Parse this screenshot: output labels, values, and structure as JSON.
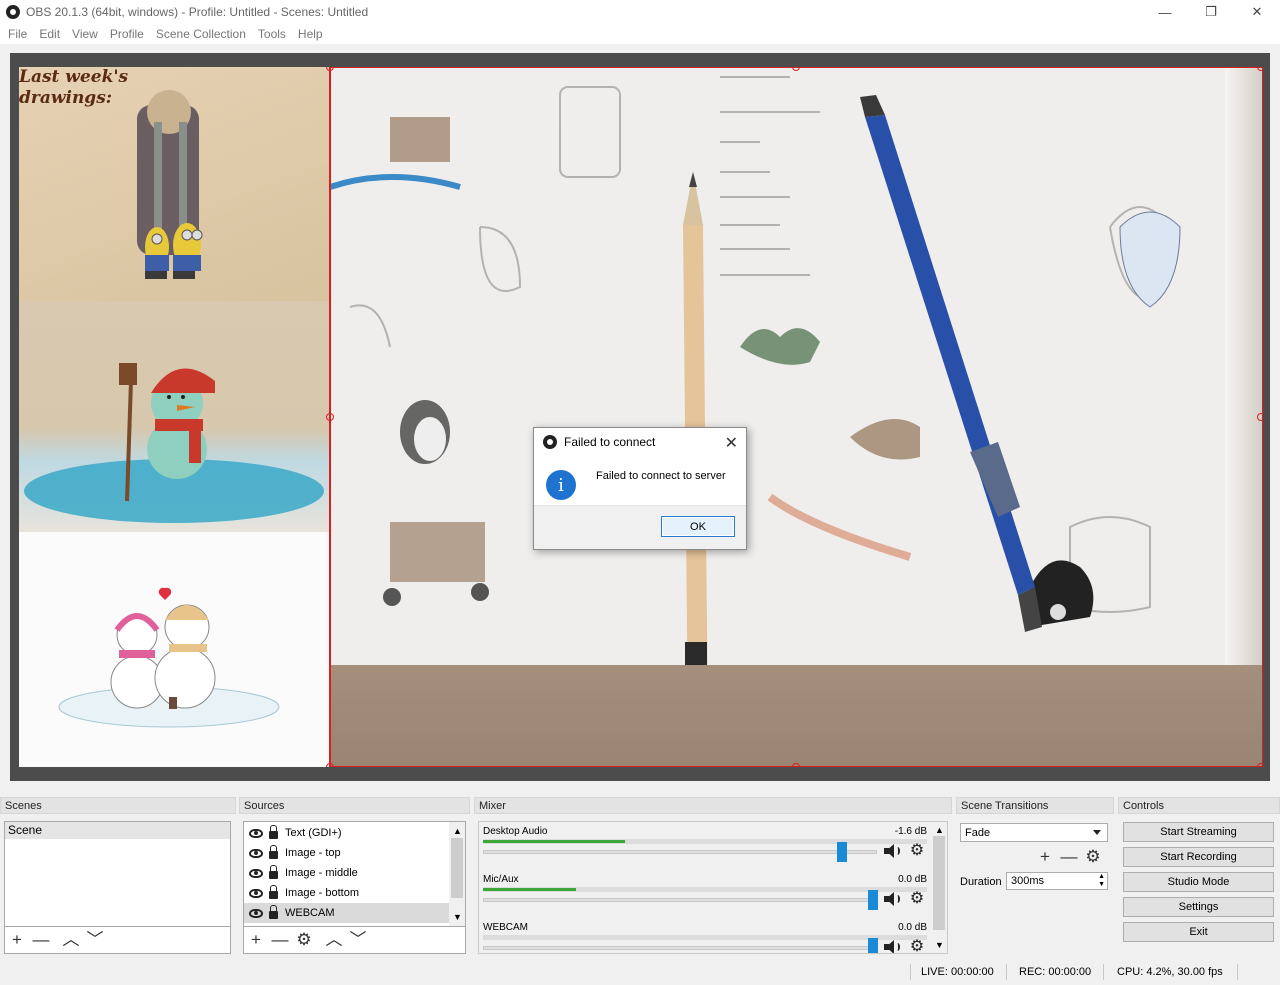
{
  "window": {
    "title": "OBS 20.1.3 (64bit, windows) - Profile: Untitled - Scenes: Untitled",
    "minimize_glyph": "—",
    "restore_glyph": "❐",
    "close_glyph": "✕"
  },
  "menu": [
    "File",
    "Edit",
    "View",
    "Profile",
    "Scene Collection",
    "Tools",
    "Help"
  ],
  "preview": {
    "overlay_text": "Last week's drawings:"
  },
  "dialog": {
    "title": "Failed to connect",
    "message": "Failed to connect to server",
    "ok_label": "OK",
    "close_glyph": "✕",
    "info_glyph": "i"
  },
  "docks": {
    "scenes": {
      "header": "Scenes",
      "items": [
        "Scene"
      ],
      "buttons": {
        "add": "+",
        "remove": "—",
        "up": "︿",
        "down": "﹀"
      }
    },
    "sources": {
      "header": "Sources",
      "items": [
        "Text (GDI+)",
        "Image - top",
        "Image - middle",
        "Image - bottom",
        "WEBCAM"
      ],
      "selected": "WEBCAM",
      "buttons": {
        "add": "+",
        "remove": "—",
        "settings": "⚙",
        "up": "︿",
        "down": "﹀"
      }
    },
    "mixer": {
      "header": "Mixer",
      "channels": [
        {
          "name": "Desktop Audio",
          "db": "-1.6 dB",
          "level": 0.32,
          "volume": 0.92
        },
        {
          "name": "Mic/Aux",
          "db": "0.0 dB",
          "level": 0.21,
          "volume": 1.0
        },
        {
          "name": "WEBCAM",
          "db": "0.0 dB",
          "level": 0.0,
          "volume": 1.0
        }
      ]
    },
    "transitions": {
      "header": "Scene Transitions",
      "selected": "Fade",
      "duration_label": "Duration",
      "duration_value": "300ms",
      "buttons": {
        "add": "+",
        "remove": "—",
        "settings": "⚙"
      }
    },
    "controls": {
      "header": "Controls",
      "buttons": [
        "Start Streaming",
        "Start Recording",
        "Studio Mode",
        "Settings",
        "Exit"
      ]
    }
  },
  "status": {
    "live": "LIVE: 00:00:00",
    "rec": "REC: 00:00:00",
    "cpu": "CPU: 4.2%, 30.00 fps"
  },
  "colors": {
    "selection_red": "#d92020",
    "info_blue": "#1e73d0",
    "fader_blue": "#1a8ad6",
    "meter_green": "#3aa63a"
  }
}
